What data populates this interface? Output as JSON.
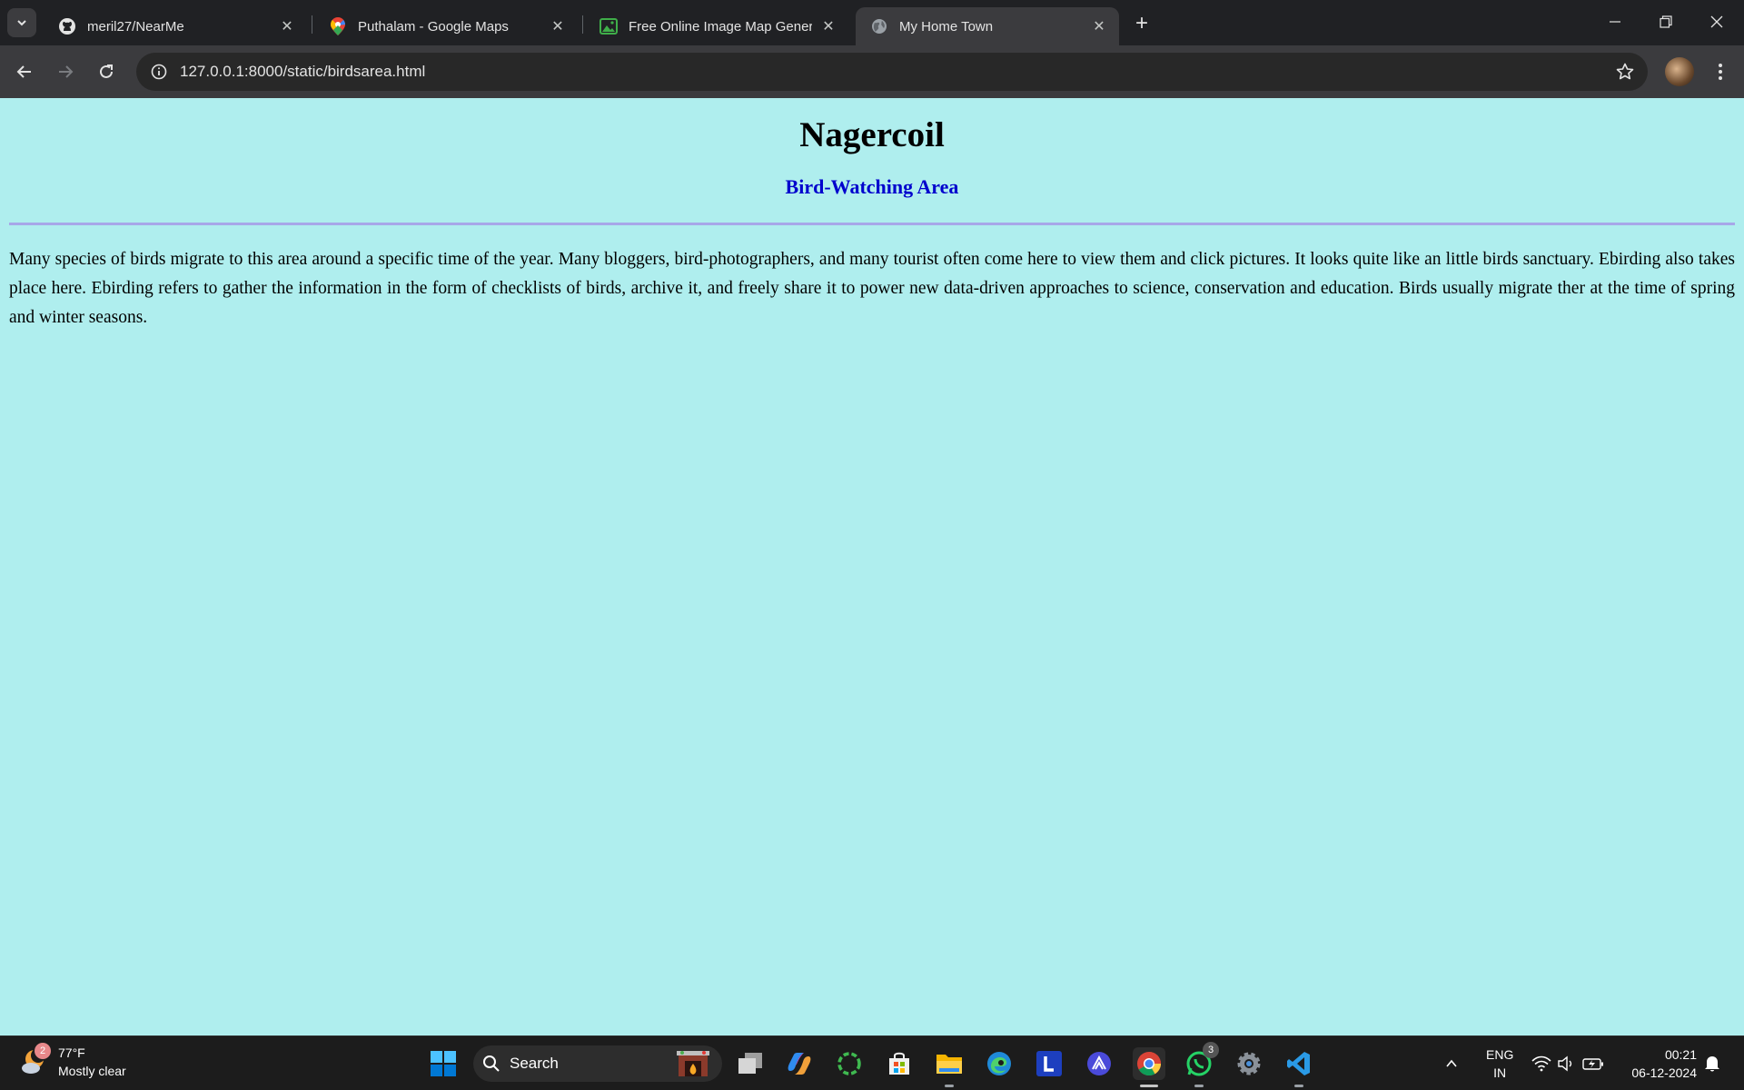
{
  "browser": {
    "tabs": [
      {
        "title": "meril27/NearMe",
        "icon": "github-icon"
      },
      {
        "title": "Puthalam - Google Maps",
        "icon": "google-maps-icon"
      },
      {
        "title": "Free Online Image Map Genera",
        "icon": "image-icon"
      },
      {
        "title": "My Home Town",
        "icon": "globe-icon"
      }
    ],
    "address_bar": {
      "url": "127.0.0.1:8000/static/birdsarea.html"
    }
  },
  "page": {
    "heading": "Nagercoil",
    "subheading": "Bird-Watching Area",
    "paragraph": "Many species of birds migrate to this area around a specific time of the year. Many bloggers, bird-photographers, and many tourist often come here to view them and click pictures. It looks quite like an little birds sanctuary. Ebirding also takes place here. Ebirding refers to gather the information in the form of checklists of birds, archive it, and freely share it to power new data-driven approaches to science, conservation and education. Birds usually migrate ther at the time of spring and winter seasons.",
    "background_color": "#afeeee",
    "subheading_color": "#0000cd"
  },
  "taskbar": {
    "weather": {
      "temp": "77°F",
      "condition": "Mostly clear",
      "badge": "2"
    },
    "search_label": "Search",
    "whatsapp_badge": "3",
    "language": {
      "line1": "ENG",
      "line2": "IN"
    },
    "clock": {
      "time": "00:21",
      "date": "06-12-2024"
    }
  }
}
